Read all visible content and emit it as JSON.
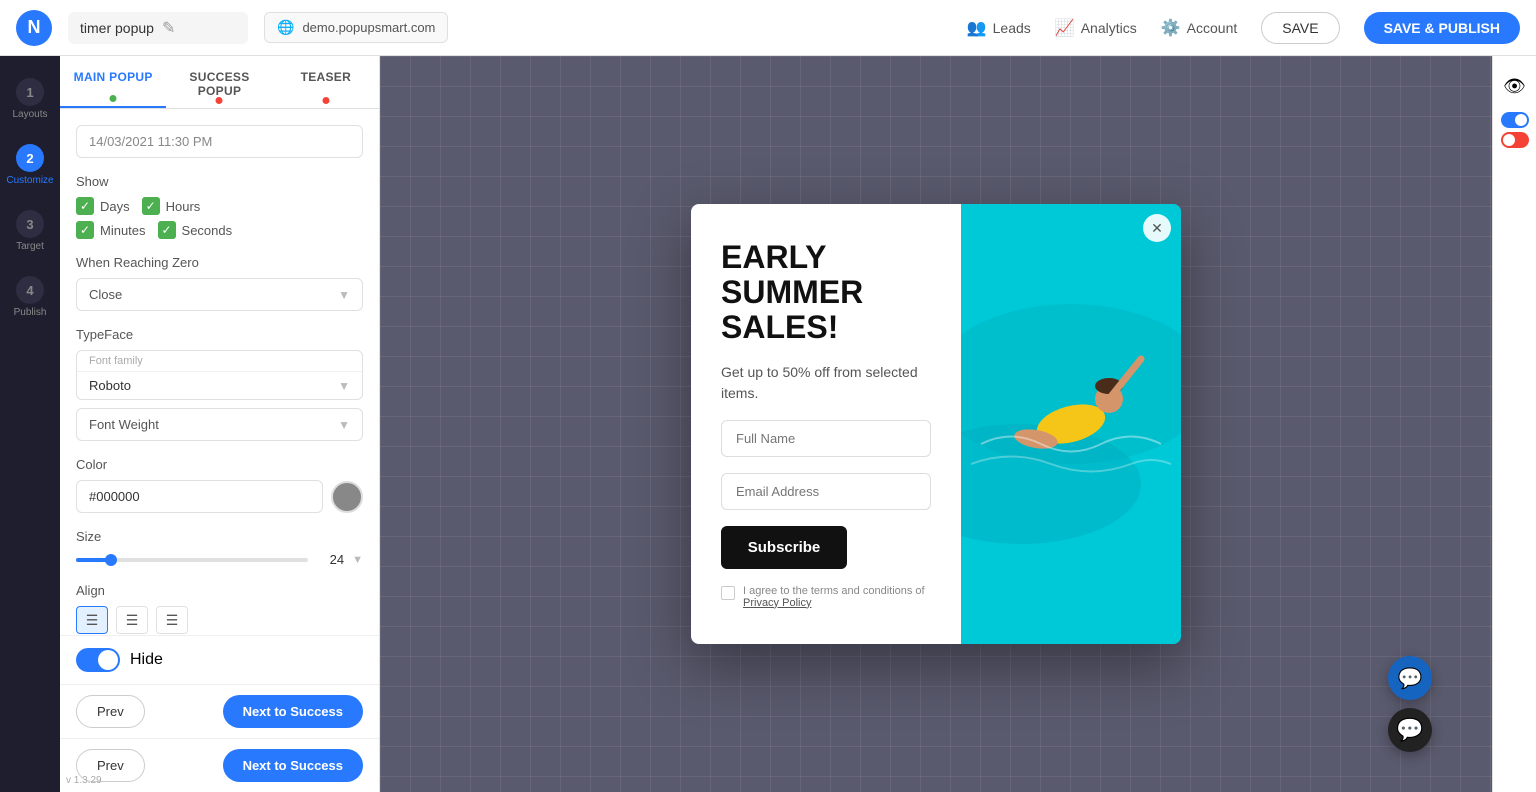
{
  "topbar": {
    "logo_letter": "N",
    "project_name": "timer popup",
    "url": "demo.popupsmart.com",
    "leads_label": "Leads",
    "analytics_label": "Analytics",
    "account_label": "Account",
    "save_label": "SAVE",
    "publish_label": "SAVE & PUBLISH"
  },
  "icon_sidebar": {
    "steps": [
      {
        "number": "1",
        "label": "Layouts"
      },
      {
        "number": "2",
        "label": "Customize"
      },
      {
        "number": "3",
        "label": "Target"
      },
      {
        "number": "4",
        "label": "Publish"
      }
    ],
    "active_step": 1
  },
  "panel": {
    "tabs": [
      {
        "label": "MAIN POPUP",
        "dot_color": "green"
      },
      {
        "label": "SUCCESS POPUP",
        "dot_color": "red"
      },
      {
        "label": "TEASER",
        "dot_color": "red"
      }
    ],
    "active_tab": 0,
    "datetime_value": "14/03/2021 11:30 PM",
    "show_label": "Show",
    "show_options": [
      {
        "label": "Days",
        "checked": true
      },
      {
        "label": "Hours",
        "checked": true
      },
      {
        "label": "Minutes",
        "checked": true
      },
      {
        "label": "Seconds",
        "checked": true
      }
    ],
    "when_reaching_zero_label": "When Reaching Zero",
    "when_reaching_zero_value": "Close",
    "typeface_label": "TypeFace",
    "font_family_label": "Font family",
    "font_family_value": "Roboto",
    "font_weight_label": "Font Weight",
    "color_label": "Color",
    "color_value": "#000000",
    "size_label": "Size",
    "size_value": "24",
    "align_label": "Align",
    "hide_label": "Hide",
    "nav": {
      "prev_label": "Prev",
      "next_label": "Next to Success"
    },
    "nav2": {
      "prev_label": "Prev",
      "next_label": "Next to Success"
    }
  },
  "popup": {
    "title": "EARLY SUMMER SALES!",
    "subtitle": "Get up to 50% off from selected items.",
    "full_name_placeholder": "Full Name",
    "email_placeholder": "Email Address",
    "subscribe_btn": "Subscribe",
    "privacy_text": "I agree to the terms and conditions of",
    "privacy_link": "Privacy Policy"
  },
  "version": "v 1.3.29"
}
